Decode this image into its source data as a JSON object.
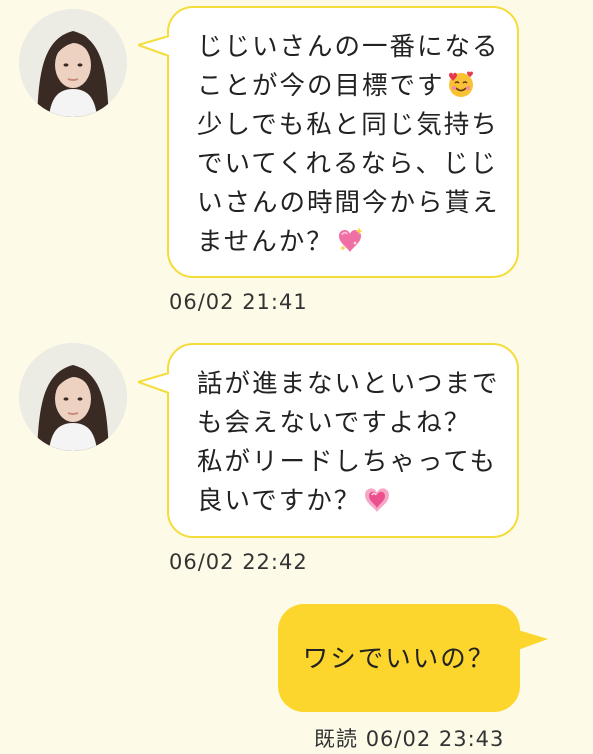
{
  "colors": {
    "background": "#fdfbe8",
    "incoming_bubble": "#ffffff",
    "incoming_border": "#f4dc3a",
    "outgoing_bubble": "#fcd62c",
    "text": "#222222"
  },
  "messages": [
    {
      "direction": "incoming",
      "avatar": "woman-portrait-avatar",
      "lines": [
        "じじいさんの一番になる",
        "ことが今の目標です",
        "少しでも私と同じ気持ち",
        "でいてくれるなら、じじ",
        "いさんの時間今から貰え",
        "ませんか？"
      ],
      "emojis": [
        "smiling-face-with-hearts-emoji",
        "sparkling-heart-emoji"
      ],
      "time": "06/02 21:41"
    },
    {
      "direction": "incoming",
      "avatar": "woman-portrait-avatar",
      "lines": [
        "話が進まないといつまで",
        "も会えないですよね？",
        "私がリードしちゃっても",
        "良いですか？"
      ],
      "emojis": [
        "growing-heart-emoji"
      ],
      "time": "06/02 22:42"
    },
    {
      "direction": "outgoing",
      "text": "ワシでいいの？",
      "read_label": "既読",
      "time": "06/02 23:43"
    }
  ]
}
